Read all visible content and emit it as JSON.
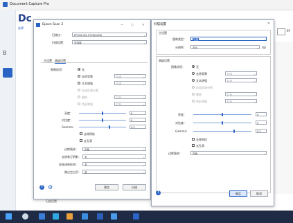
{
  "app": {
    "title": "Document Capture Pro",
    "big_letters": "Dc",
    "link_text": "选择"
  },
  "sidebar": {
    "icons": [
      "scan-icon",
      "document-icon",
      "settings-icon"
    ]
  },
  "bg_right": {
    "truncated_label": "EP"
  },
  "scan_dialog": {
    "title": "Epson Scan 2",
    "controls": [
      "—",
      "☐",
      "✕"
    ],
    "scanner_label": "扫描仪：",
    "scanner_value": "EPSON DS-570W(USB)",
    "scan_setting_label": "扫描设置：",
    "scan_setting_value": "未选择",
    "tabs": [
      "主设置",
      "高级设置"
    ],
    "image_option_label": "图像选项：",
    "radio_none": "无",
    "radio_enhance_text": "去除背景",
    "radio_text_enhance": "文本增强",
    "radio_auto_area": "自动区域分割",
    "radio_dropout": "删除",
    "radio_color_enhance": "色彩增强",
    "dd_standard": "标准",
    "dd_red": "红色",
    "brightness_label": "亮度：",
    "brightness_value": "0",
    "contrast_label": "对比度：",
    "contrast_value": "0",
    "gamma_label": "Gamma：",
    "gamma_value": "2.2",
    "chk_moire": "去除网纹",
    "chk_punch": "去孔洞",
    "edge_fill_label": "边缘填充：",
    "edge_fill_value": "白色",
    "shadow_label": "去除装订阴影：",
    "shadow_value": "关",
    "detect_label": "双张进纸检测：",
    "detect_value": "关",
    "skip_label": "跳过空白页：",
    "skip_value": "关",
    "preview_btn": "预览",
    "scan_btn": "扫描",
    "behind_label": "扫描设置"
  },
  "settings_dialog": {
    "title": "扫描设置",
    "close": "✕",
    "main_section": "主设置",
    "image_type_label": "图像类型：",
    "image_type_value": "灰度",
    "resolution_label": "分辨率：",
    "resolution_value": "300",
    "resolution_unit": "dpi",
    "advanced_section": "高级设置",
    "image_option_label": "图像选项：",
    "radio_none": "无",
    "radio_remove_bg": "去除背景",
    "radio_text_enhance": "文本增强",
    "radio_auto_area": "自动区域分割",
    "radio_dropout": "删除",
    "radio_color_enhance": "色彩增强",
    "dd_standard": "标准",
    "dd_red": "红色",
    "brightness_label": "亮度：",
    "brightness_value": "0",
    "contrast_label": "对比度：",
    "contrast_value": "0",
    "gamma_label": "Gamma：",
    "gamma_value": "2.2",
    "chk_moire": "去除网纹",
    "chk_punch": "去孔洞",
    "edge_fill_label": "边缘填充：",
    "edge_fill_value": "白色",
    "ok_btn": "确定",
    "cancel_btn": "取消"
  },
  "taskbar": {
    "icons": [
      "start-icon",
      "search-icon",
      "edge-icon",
      "mail-icon",
      "store-icon",
      "explorer-icon",
      "word-icon",
      "app-icon",
      "scan-app-icon"
    ]
  },
  "colors": {
    "accent": "#2a64c5",
    "taskbar": "#1f2a44"
  }
}
